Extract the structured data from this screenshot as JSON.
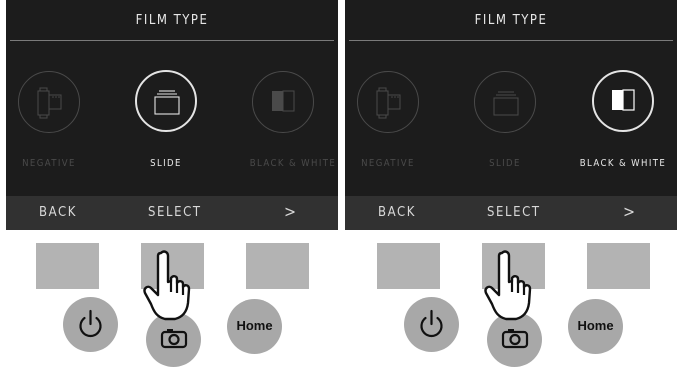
{
  "panels": [
    {
      "title": "FILM TYPE",
      "options": [
        "NEGATIVE",
        "SLIDE",
        "BLACK & WHITE"
      ],
      "selected": "SLIDE",
      "nav": {
        "back": "BACK",
        "select": "SELECT",
        "next": ">"
      }
    },
    {
      "title": "FILM TYPE",
      "options": [
        "NEGATIVE",
        "SLIDE",
        "BLACK & WHITE"
      ],
      "selected": "BLACK & WHITE",
      "nav": {
        "back": "BACK",
        "select": "SELECT",
        "next": ">"
      }
    }
  ],
  "hardware": [
    {
      "home_label": "Home",
      "icons": [
        "power-icon",
        "camera-icon",
        "pointing-hand-icon"
      ]
    },
    {
      "home_label": "Home",
      "icons": [
        "power-icon",
        "camera-icon",
        "pointing-hand-icon"
      ]
    }
  ]
}
